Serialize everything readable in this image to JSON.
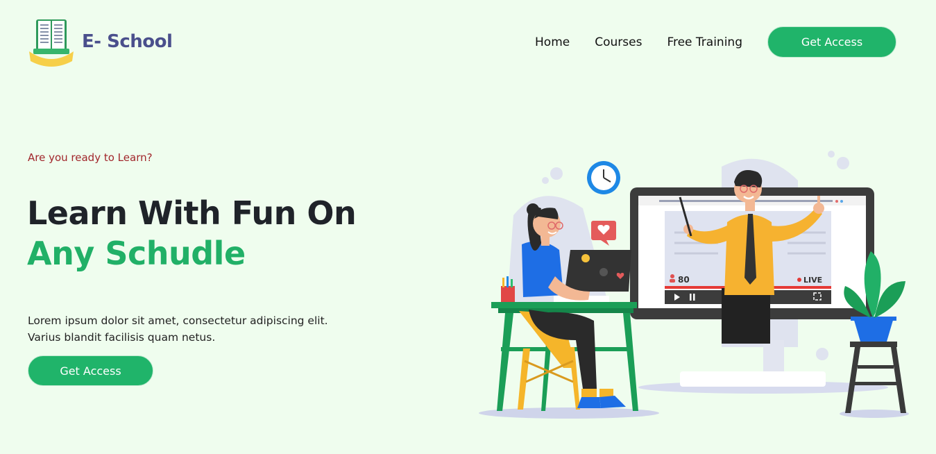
{
  "brand": {
    "name": "E- School",
    "logo_icon": "open-book-logo-icon"
  },
  "nav": {
    "links": [
      "Home",
      "Courses",
      "Free Training"
    ],
    "cta_label": "Get Access"
  },
  "hero": {
    "eyebrow": "Are you ready to Learn?",
    "headline_line1": "Learn With Fun On",
    "headline_line2": "Any Schudle",
    "description_line1": "Lorem ipsum dolor sit amet, consectetur adipiscing elit.",
    "description_line2": "Varius blandit facilisis quam netus.",
    "cta_label": "Get Access"
  },
  "illustration": {
    "viewers_count": "80",
    "live_label": "LIVE"
  },
  "colors": {
    "background": "#effdee",
    "accent_green": "#20b46a",
    "brand_text": "#4a4f8c",
    "eyebrow_red": "#a1262b"
  }
}
